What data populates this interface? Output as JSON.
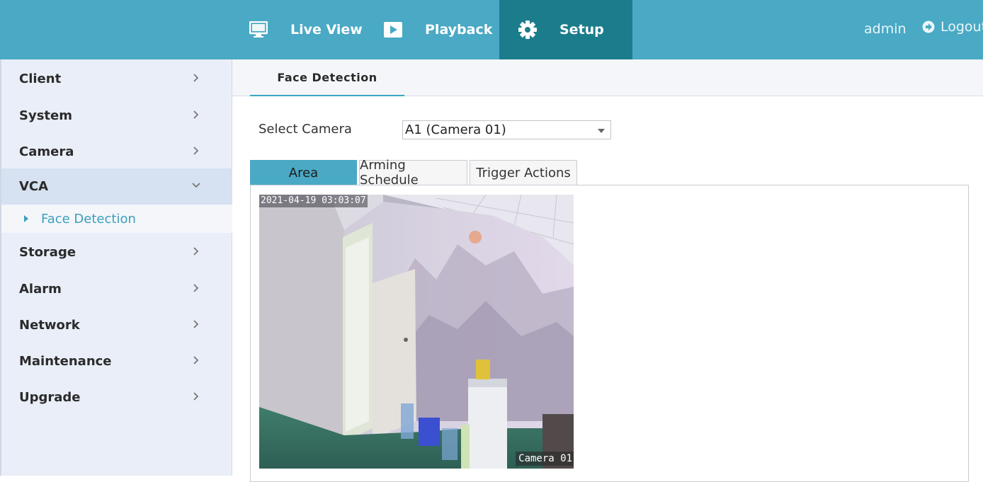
{
  "header": {
    "nav": [
      {
        "label": "Live View",
        "icon": "monitor-icon"
      },
      {
        "label": "Playback",
        "icon": "play-icon"
      },
      {
        "label": "Setup",
        "icon": "gear-icon",
        "active": true
      }
    ],
    "user": "admin",
    "logout_label": "Logout",
    "colors": {
      "bar": "#4aa9c4",
      "active": "#1b7d8c"
    }
  },
  "sidebar": {
    "items": [
      {
        "label": "Client"
      },
      {
        "label": "System"
      },
      {
        "label": "Camera"
      },
      {
        "label": "VCA",
        "expanded": true
      },
      {
        "label": "Storage"
      },
      {
        "label": "Alarm"
      },
      {
        "label": "Network"
      },
      {
        "label": "Maintenance"
      },
      {
        "label": "Upgrade"
      }
    ],
    "sub_item": {
      "label": "Face Detection",
      "parent": "VCA"
    }
  },
  "content": {
    "tab": "Face Detection",
    "select_label": "Select Camera",
    "select_value": "A1 (Camera 01)",
    "subtabs": [
      "Area",
      "Arming Schedule",
      "Trigger Actions"
    ],
    "active_subtab": "Area",
    "camera": {
      "timestamp": "2021-04-19  03:03:07",
      "name": "Camera 01"
    }
  }
}
